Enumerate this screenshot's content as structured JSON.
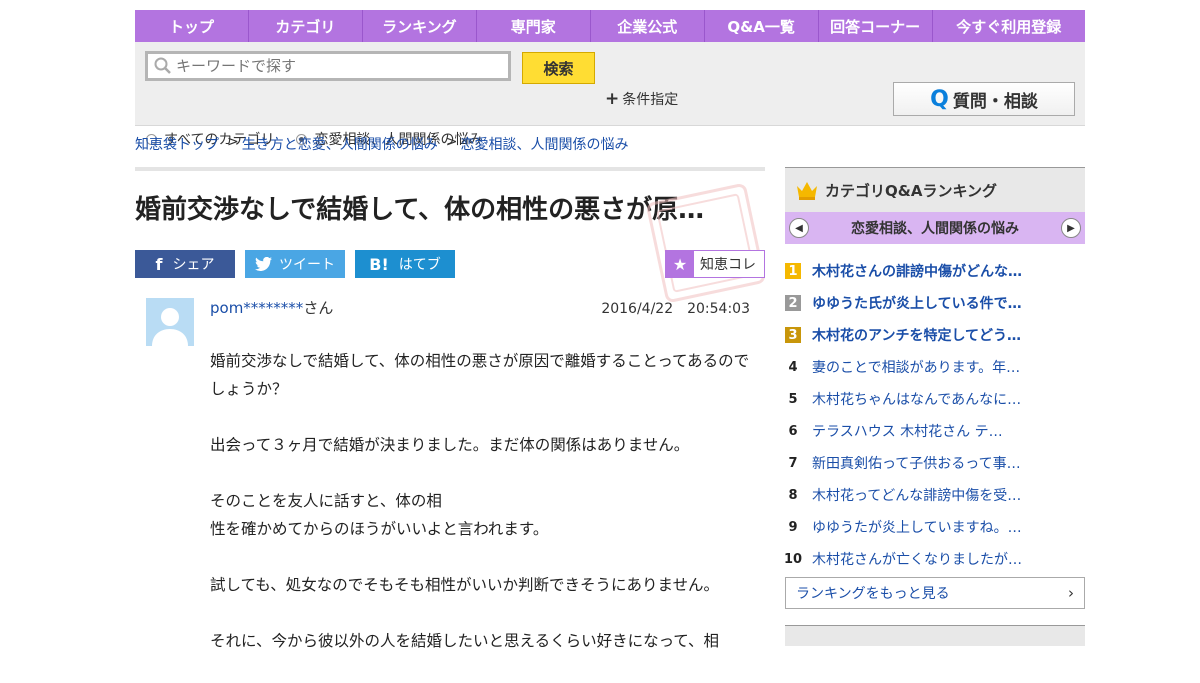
{
  "nav": [
    "トップ",
    "カテゴリ",
    "ランキング",
    "専門家",
    "企業公式",
    "Q&A一覧",
    "回答コーナー",
    "今すぐ利用登録"
  ],
  "search": {
    "placeholder": "キーワードで探す",
    "button": "検索",
    "conditions": "条件指定",
    "ask": "質問・相談"
  },
  "radios": [
    {
      "label": "すべてのカテゴリ",
      "selected": false
    },
    {
      "label": "恋愛相談、人間関係の悩み",
      "selected": true
    }
  ],
  "breadcrumbs": [
    "知恵袋トップ",
    "生き方と恋愛、人間関係の悩み",
    "恋愛相談、人間関係の悩み"
  ],
  "question": {
    "title": "婚前交渉なしで結婚して、体の相性の悪さが原…",
    "user": "pom********",
    "user_suffix": "さん",
    "date": "2016/4/22　20:54:03",
    "paragraphs": [
      "婚前交渉なしで結婚して、体の相性の悪さが原因で離婚することってあるのでしょうか？",
      "出会って３ヶ月で結婚が決まりました。まだ体の関係はありません。",
      "そのことを友人に話すと、体の相\n性を確かめてからのほうがいいよと言われます。",
      "試しても、処女なのでそもそも相性がいいか判断できそうにありません。",
      "それに、今から彼以外の人を結婚したいと思えるくらい好きになって、相"
    ]
  },
  "share": {
    "facebook": "シェア",
    "twitter": "ツイート",
    "hatena": "はてブ",
    "collect": "知恵コレ"
  },
  "sidebar": {
    "title": "カテゴリQ&Aランキング",
    "category": "恋愛相談、人間関係の悩み",
    "ranks": [
      {
        "n": "1",
        "text": "木村花さんの誹謗中傷がどんな…",
        "color": "#f5b800"
      },
      {
        "n": "2",
        "text": "ゆゆうた氏が炎上している件で…",
        "color": "#999999"
      },
      {
        "n": "3",
        "text": "木村花のアンチを特定してどう…",
        "color": "#c8960a"
      },
      {
        "n": "4",
        "text": "妻のことで相談があります。年…"
      },
      {
        "n": "5",
        "text": "木村花ちゃんはなんであんなに…"
      },
      {
        "n": "6",
        "text": "テラスハウス 木村花さん テ…"
      },
      {
        "n": "7",
        "text": "新田真剣佑って子供おるって事…"
      },
      {
        "n": "8",
        "text": "木村花ってどんな誹謗中傷を受…"
      },
      {
        "n": "9",
        "text": "ゆゆうたが炎上していますね。…"
      },
      {
        "n": "10",
        "text": "木村花さんが亡くなりましたが…"
      }
    ],
    "more": "ランキングをもっと見る"
  }
}
